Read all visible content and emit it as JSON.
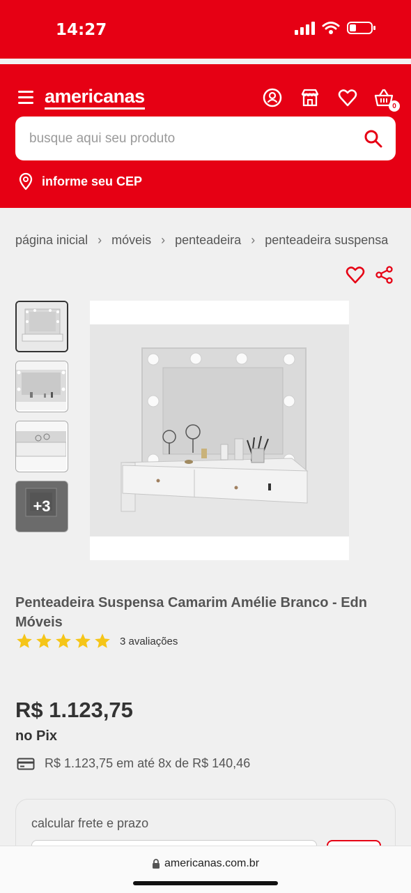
{
  "status_bar": {
    "time": "14:27"
  },
  "header": {
    "logo": "americanas",
    "cart_count": "0",
    "search": {
      "placeholder": "busque aqui seu produto"
    },
    "cep_label": "informe seu CEP"
  },
  "breadcrumb": [
    "página inicial",
    "móveis",
    "penteadeira",
    "penteadeira suspensa"
  ],
  "gallery": {
    "more_label": "+3"
  },
  "product": {
    "title": "Penteadeira Suspensa Camarim Amélie Branco - Edn Móveis",
    "rating": 5,
    "reviews": "3 avaliações",
    "price": "R$ 1.123,75",
    "price_note": "no Pix",
    "installment": "R$ 1.123,75 em até 8x de R$ 140,46"
  },
  "freight": {
    "label": "calcular frete e prazo"
  },
  "browser": {
    "url": "americanas.com.br"
  },
  "colors": {
    "brand": "#e60014",
    "star": "#f5c518"
  }
}
